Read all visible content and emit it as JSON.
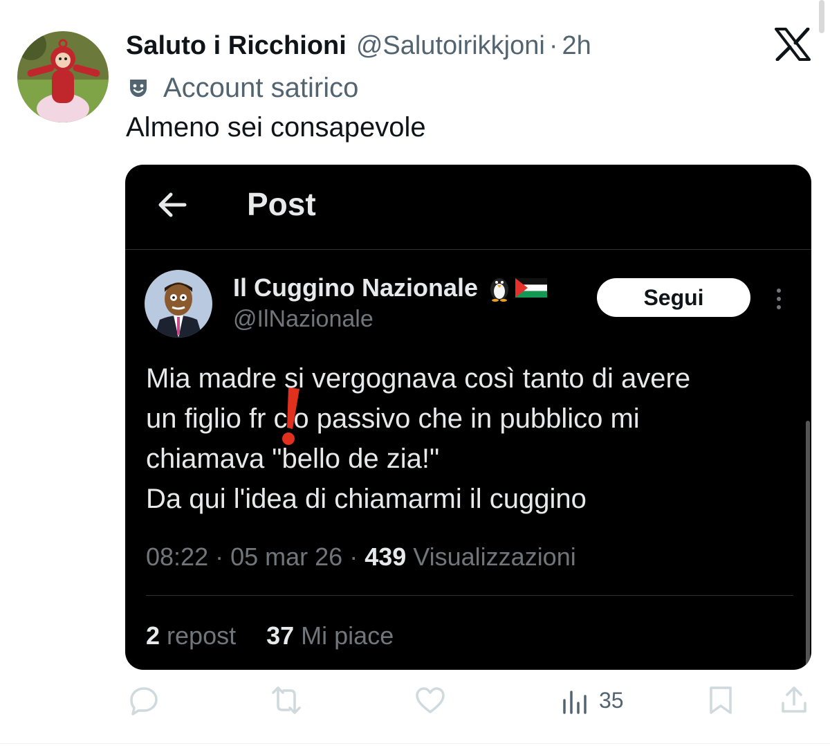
{
  "tweet": {
    "display_name": "Saluto i Ricchioni",
    "handle": "@Salutoirikkjoni",
    "separator": "·",
    "time": "2h",
    "label": "Account satirico",
    "text": "Almeno sei consapevole",
    "platform_icon": "x-logo-icon",
    "avatar_icon": "teletubby-avatar"
  },
  "quoted_screenshot": {
    "header_title": "Post",
    "author": {
      "name": "Il Cuggino Nazionale",
      "emoji": [
        "penguin-icon",
        "palestine-flag-icon"
      ],
      "handle": "@IlNazionale"
    },
    "follow_label": "Segui",
    "body": "Mia madre si vergognava così tanto di avere\nun figlio fr cio passivo che in pubblico mi\nchiamava \"bello de zia!\"\nDa qui l'idea di chiamarmi il cuggino",
    "meta": {
      "time": "08:22",
      "sep1": " · ",
      "date": "05 mar 26",
      "sep2": " · ",
      "views": "439",
      "views_label": " Visualizzazioni"
    },
    "stats": {
      "reposts": "2",
      "reposts_label": " repost",
      "likes": "37",
      "likes_label": " Mi piace"
    }
  },
  "actions": {
    "reply_icon": "reply-icon",
    "retweet_icon": "retweet-icon",
    "like_icon": "like-icon",
    "views_icon": "views-icon",
    "views_count": "35",
    "bookmark_icon": "bookmark-icon",
    "share_icon": "share-icon"
  },
  "colors": {
    "secondary_text": "#536471",
    "card_background": "#000000",
    "exclaim_red": "#e0301e"
  }
}
